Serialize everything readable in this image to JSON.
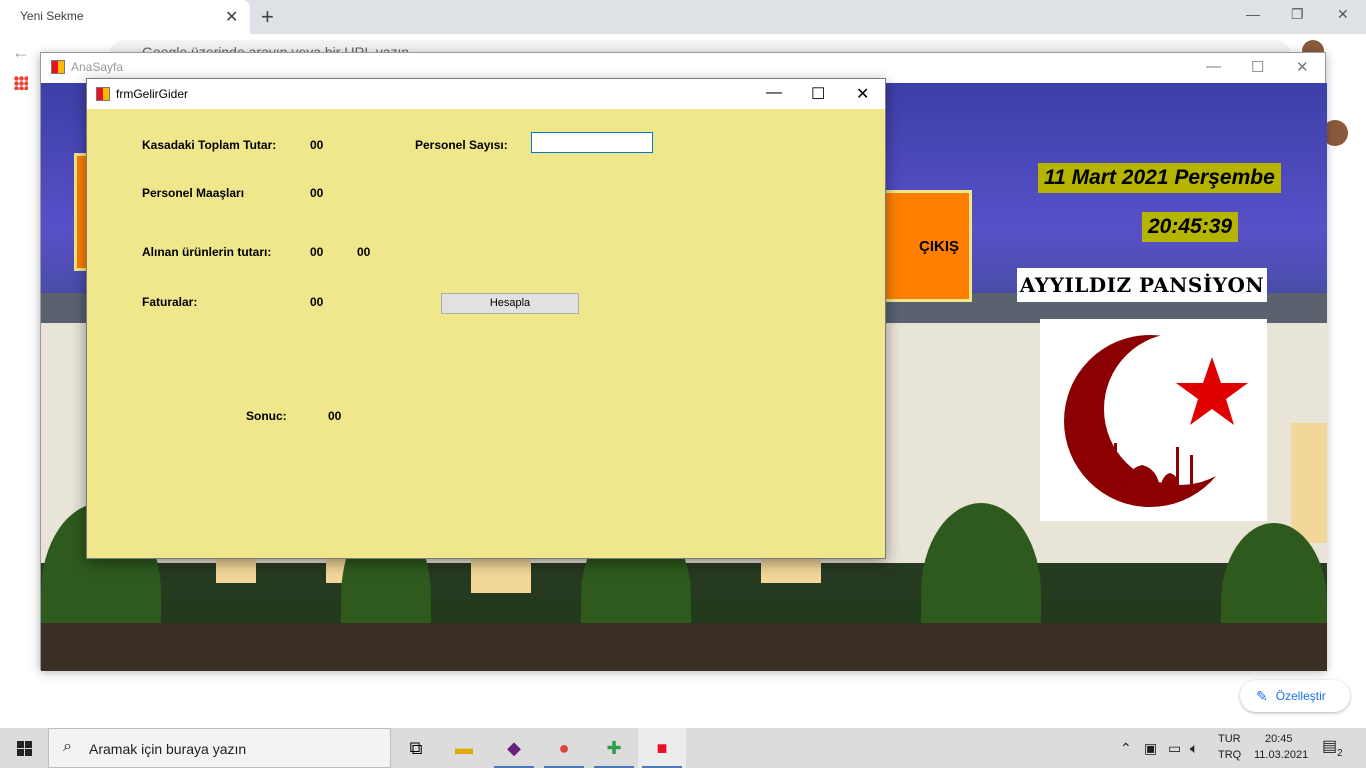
{
  "browser": {
    "tab_title": "Yeni Sekme",
    "tab_close": "✕",
    "new_tab": "+",
    "omnibox_placeholder": "Google üzerinde arayın veya bir URL yazın",
    "customize_label": "Özelleştir"
  },
  "ana_window": {
    "title": "AnaSayfa",
    "right_button_label": "ÇIKIŞ",
    "date": "11 Mart 2021 Perşembe",
    "time": "20:45:39",
    "brand": "AYYILDIZ PANSİYON"
  },
  "dialog": {
    "title": "frmGelirGider",
    "labels": {
      "kasa": "Kasadaki Toplam Tutar:",
      "personel_sayisi": "Personel Sayısı:",
      "maaslar": "Personel Maaşları",
      "urunler": "Alınan ürünlerin tutarı:",
      "faturalar": "Faturalar:",
      "sonuc": "Sonuc:"
    },
    "values": {
      "kasa": "00",
      "maaslar": "00",
      "urunler_1": "00",
      "urunler_2": "00",
      "faturalar": "00",
      "sonuc": "00"
    },
    "personel_sayisi_value": "",
    "hesapla_label": "Hesapla"
  },
  "taskbar": {
    "search_placeholder": "Aramak için buraya yazın",
    "lang_1": "TUR",
    "lang_2": "TRQ",
    "clock_time": "20:45",
    "clock_date": "11.03.2021",
    "notification_count": "2"
  },
  "colors": {
    "form_background": "#f0e68c",
    "orange_button": "#ff8000",
    "date_highlight": "#b5b500",
    "input_focus": "#0078d7"
  }
}
